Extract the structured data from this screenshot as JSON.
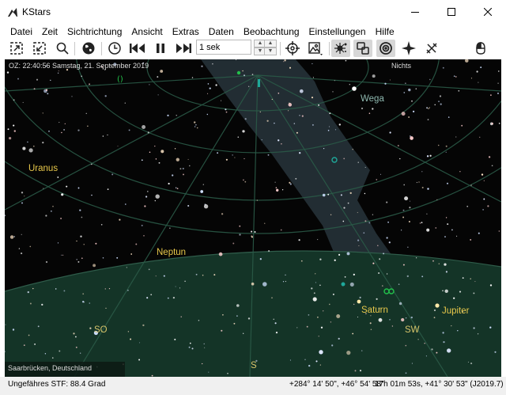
{
  "window": {
    "title": "KStars"
  },
  "menu": [
    "Datei",
    "Zeit",
    "Sichtrichtung",
    "Ansicht",
    "Extras",
    "Daten",
    "Beobachtung",
    "Einstellungen",
    "Hilfe"
  ],
  "toolbar": {
    "time_step": "1 sek",
    "icons": [
      "zoom-to-fit-icon",
      "zoom-out-icon",
      "search-icon",
      "globe-icon",
      "clock-icon",
      "step-back-icon",
      "pause-icon",
      "step-forward-icon",
      "crosshair-icon",
      "image-icon",
      "stars-icon",
      "layers-icon",
      "target-icon",
      "sparkle-icon",
      "tools-icon",
      "mouse-icon"
    ]
  },
  "hud": {
    "time": "OZ: 22:40:56",
    "date": "Samstag, 21. September 2019",
    "focus": "Nichts",
    "location": "Saarbrücken, Deutschland"
  },
  "labels": {
    "objects": [
      "Wega",
      "Uranus",
      "Neptun",
      "Saturn",
      "Jupiter"
    ],
    "directions": [
      "SO",
      "S",
      "SW"
    ]
  },
  "status": {
    "fov": "Ungefähres STF: 88.4 Grad",
    "coord_horizontal": "+284° 14' 50\", +46° 54' 58\"",
    "coord_equatorial": "17h 01m 53s, +41° 30' 53\" (J2019.7)"
  },
  "colors": {
    "sky": "#050505",
    "ground": "#143427",
    "grid": "#2a5a47",
    "milky_way": "#263238",
    "planet_label": "#e8c84a",
    "star_label": "#8fb9b0"
  }
}
